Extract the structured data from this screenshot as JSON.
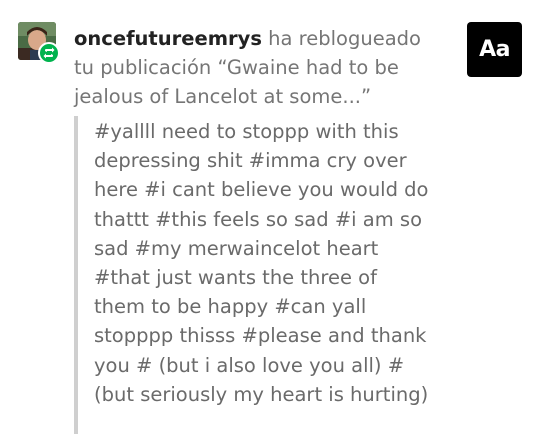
{
  "notification": {
    "username": "oncefutureemrys",
    "action_text": " ha reblogueado tu publicación “Gwaine had to be jealous of Lancelot at some...”",
    "tags_text": "#yallll need to stoppp with this depressing shit #imma cry over here #i cant believe you would do thattt #this feels so sad #i am so sad #my merwaincelot heart #that just wants the three of them to be happy #can yall stopppp thisss #please and thank you # (but i also love you all) #(but seriously my heart is hurting)"
  },
  "font_button": {
    "label": "Aa"
  },
  "icons": {
    "avatar": "user-avatar",
    "badge": "reblog-icon"
  },
  "colors": {
    "badge_green": "#00b34e",
    "button_bg": "#000000",
    "quote_bar": "#cfcfcf"
  }
}
